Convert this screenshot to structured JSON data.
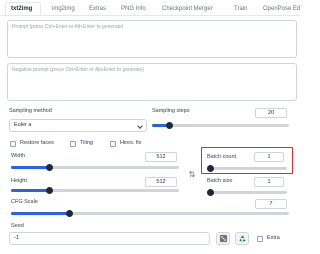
{
  "tabs": [
    {
      "label": "txt2img"
    },
    {
      "label": "img2img"
    },
    {
      "label": "Extras"
    },
    {
      "label": "PNG Info"
    },
    {
      "label": "Checkpoint Merger"
    },
    {
      "label": "Train"
    },
    {
      "label": "OpenPose Ed"
    }
  ],
  "prompt": {
    "placeholder": "Prompt (press Ctrl+Enter or Alt+Enter to generate)"
  },
  "negative_prompt": {
    "placeholder": "Negative prompt (press Ctrl+Enter or Alt+Enter to generate)"
  },
  "sampling_method": {
    "label": "Sampling method",
    "value": "Euler a"
  },
  "sampling_steps": {
    "label": "Sampling steps",
    "value": "20",
    "fraction": 0.13
  },
  "checkboxes": {
    "restore_faces": "Restore faces",
    "tiling": "Tiling",
    "hires_fix": "Hires. fix"
  },
  "width": {
    "label": "Width",
    "value": "512",
    "fraction": 0.23
  },
  "height": {
    "label": "Height",
    "value": "512",
    "fraction": 0.23
  },
  "swap_icon": "⇅",
  "batch_count": {
    "label": "Batch count",
    "value": "1",
    "fraction": 0.0
  },
  "batch_size": {
    "label": "Batch size",
    "value": "1",
    "fraction": 0.0
  },
  "cfg_scale": {
    "label": "CFG Scale",
    "value": "7",
    "fraction": 0.21
  },
  "seed": {
    "label": "Seed",
    "value": "-1"
  },
  "extra": {
    "label": "Extra"
  },
  "colors": {
    "accent": "#2563eb",
    "highlight": "#d32f2f"
  }
}
